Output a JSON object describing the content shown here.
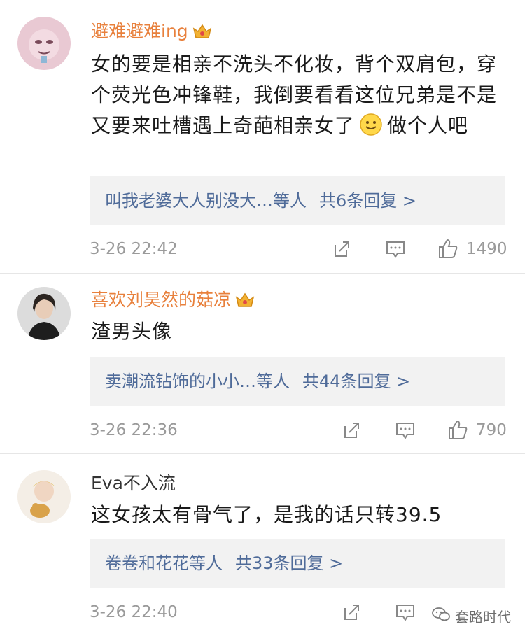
{
  "comments": [
    {
      "username": "避难避难ing",
      "vip": true,
      "text_before": "女的要是相亲不洗头不化妆，背个双肩包，穿个荧光色冲锋鞋，我倒要看看这位兄弟是不是又要来吐槽遇上奇葩相亲女了",
      "text_after": "做个人吧",
      "has_emoji": true,
      "reply_preview": "叫我老婆大人别没大…等人",
      "reply_count": "共6条回复 >",
      "time": "3-26 22:42",
      "likes": "1490"
    },
    {
      "username": "喜欢刘昊然的菇凉",
      "vip": true,
      "text_before": "渣男头像",
      "text_after": "",
      "has_emoji": false,
      "reply_preview": "卖潮流钻饰的小小…等人",
      "reply_count": "共44条回复 >",
      "time": "3-26 22:36",
      "likes": "790"
    },
    {
      "username": "Eva不入流",
      "vip": false,
      "text_before": "这女孩太有骨气了，是我的话只转39.5",
      "text_after": "",
      "has_emoji": false,
      "reply_preview": "卷卷和花花等人",
      "reply_count": "共33条回复 >",
      "time": "3-26 22:40",
      "likes": ""
    }
  ],
  "watermark": "套路时代",
  "icons": {
    "crown": "crown-icon",
    "share": "share-icon",
    "comment": "comment-icon",
    "like": "thumbs-up-icon",
    "emoji": "smile-emoji-icon"
  },
  "colors": {
    "vip_name": "#e8803c",
    "link": "#4f6b99",
    "meta": "#9a9a9a"
  }
}
